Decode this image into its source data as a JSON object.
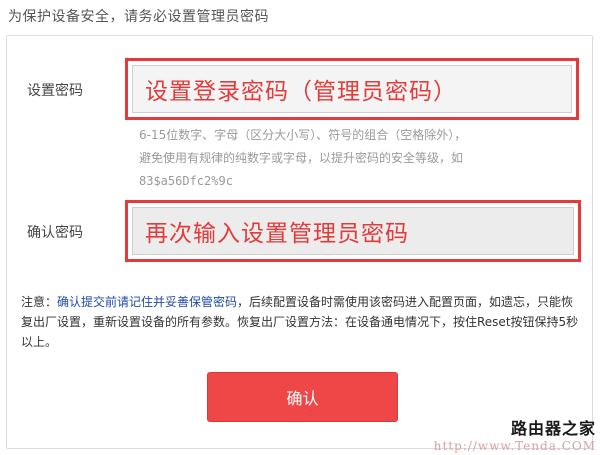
{
  "top_note": "为保护设备安全，请务必设置管理员密码",
  "form": {
    "password_label": "设置密码",
    "password_value": "设置登录密码（管理员密码）",
    "hint_line1": "6-15位数字、字母（区分大小写）、符号的组合（空格除外），",
    "hint_line2": "避免使用有规律的纯数字或字母，以提升密码的安全等级，如",
    "hint_line3": "83$a56Dfc2%9c",
    "confirm_label": "确认密码",
    "confirm_value": "再次输入设置管理员密码"
  },
  "notice": {
    "prefix": "注意：",
    "highlight": "确认提交前请记住并妥善保管密码",
    "rest": "，后续配置设备时需使用该密码进入配置页面，如遗忘，只能恢复出厂设置，重新设置设备的所有参数。恢复出厂设置方法：在设备通电情况下，按住Reset按钮保持5秒以上。"
  },
  "button": {
    "confirm_label": "确认"
  },
  "watermark": {
    "brand": "路由器之家",
    "url": "http://www.Tenda.COM"
  },
  "colors": {
    "accent_red": "#e53a3a",
    "button_red": "#ef4747",
    "link_blue": "#1e4aa8"
  }
}
